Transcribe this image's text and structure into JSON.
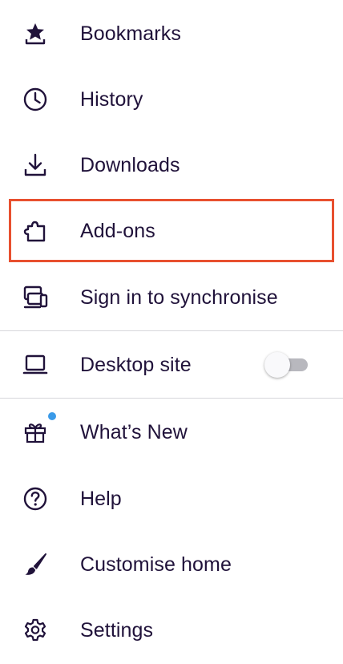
{
  "menu": {
    "items": [
      {
        "label": "Bookmarks",
        "icon": "bookmark-star-icon"
      },
      {
        "label": "History",
        "icon": "clock-icon"
      },
      {
        "label": "Downloads",
        "icon": "download-icon"
      },
      {
        "label": "Add-ons",
        "icon": "puzzle-piece-icon"
      },
      {
        "label": "Sign in to synchronise",
        "icon": "sync-devices-icon"
      },
      {
        "label": "Desktop site",
        "icon": "laptop-icon",
        "toggle_on": false
      },
      {
        "label": "What’s New",
        "icon": "gift-icon",
        "has_notification_dot": true
      },
      {
        "label": "Help",
        "icon": "help-circle-icon"
      },
      {
        "label": "Customise home",
        "icon": "brush-icon"
      },
      {
        "label": "Settings",
        "icon": "gear-icon"
      }
    ]
  },
  "colors": {
    "text": "#20123a",
    "highlight_border": "#e8502f",
    "divider": "#d7d7db",
    "notification_dot": "#3a9ae8",
    "toggle_track_off": "#b8b8be"
  }
}
